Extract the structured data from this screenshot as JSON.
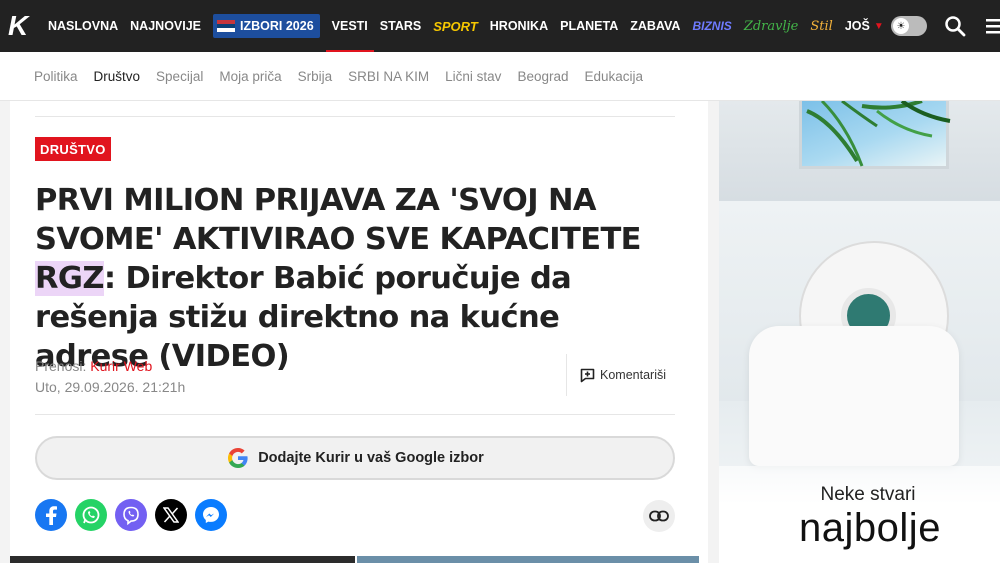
{
  "logo": {
    "letter": "K"
  },
  "nav": {
    "items": [
      {
        "label": "NASLOVNA"
      },
      {
        "label": "NAJNOVIJE"
      }
    ],
    "izbori_label": "IZBORI 2026",
    "items_after": [
      {
        "label": "VESTI",
        "active": true
      },
      {
        "label": "STARS"
      },
      {
        "label": "SPORT"
      },
      {
        "label": "HRONIKA"
      },
      {
        "label": "PLANETA"
      },
      {
        "label": "ZABAVA"
      },
      {
        "label": "BIZNIS"
      },
      {
        "label": "Zdravlje"
      },
      {
        "label": "Stil"
      },
      {
        "label": "JOŠ"
      }
    ]
  },
  "subnav": {
    "items": [
      "Politika",
      "Društvo",
      "Specijal",
      "Moja priča",
      "Srbija",
      "SRBI NA KIM",
      "Lični stav",
      "Beograd",
      "Edukacija"
    ],
    "active": "Društvo"
  },
  "article": {
    "category": "DRUŠTVO",
    "headline_part1": "PRVI MILION PRIJAVA ZA 'SVOJ NA SVOME' AKTIVIRAO SVE KAPACITETE",
    "headline_highlight": "RGZ",
    "headline_part2": ": Direktor Babić poručuje da rešenja stižu direktno na kućne adrese (VIDEO)",
    "source_label": "Prenosi:",
    "source_name": "Kurir Web",
    "date": "Uto, 29.09.2026. 21:21h",
    "comment_label": "Komentariši",
    "google_label": "Dodajte Kurir u vaš Google izbor"
  },
  "share": [
    "facebook",
    "whatsapp",
    "viber",
    "x",
    "messenger"
  ],
  "ad": {
    "line1": "Neke stvari",
    "line2": "najbolje"
  },
  "colors": {
    "brand_red": "#e1141e",
    "highlight": "#ecd5f7",
    "nav_bg": "#222222",
    "izbori_bg": "#1d4e9e"
  }
}
